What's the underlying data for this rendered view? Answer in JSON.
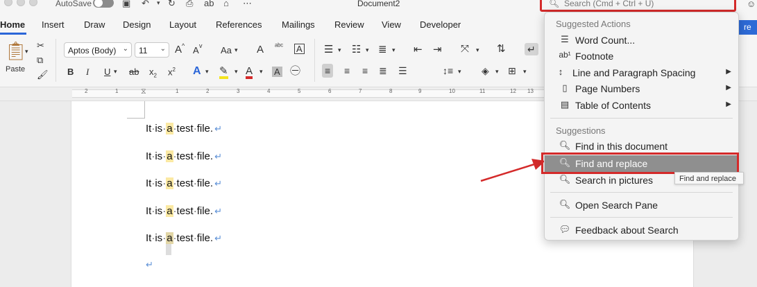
{
  "titlebar": {
    "autosave_label": "AutoSave",
    "document_title": "Document2",
    "search_placeholder": "Search (Cmd + Ctrl + U)"
  },
  "tabs": [
    "Home",
    "Insert",
    "Draw",
    "Design",
    "Layout",
    "References",
    "Mailings",
    "Review",
    "View",
    "Developer"
  ],
  "share_label": "re",
  "ribbon": {
    "paste_label": "Paste",
    "font_name": "Aptos (Body)",
    "font_size": "11",
    "bold": "B",
    "italic": "I",
    "underline": "U",
    "strike": "ab",
    "subscript": "x",
    "superscript": "x",
    "grow_font": "A",
    "shrink_font": "A",
    "change_case": "Aa",
    "text_effects": "A",
    "font_color": "A",
    "shading": "A",
    "clear_format": "A"
  },
  "ruler_numbers": [
    "2",
    "1",
    "1",
    "2",
    "3",
    "4",
    "5",
    "6",
    "7",
    "8",
    "9",
    "10",
    "11",
    "12",
    "13"
  ],
  "document": {
    "lines": [
      {
        "before": "It",
        "word2": "is",
        "highlight": "a",
        "word4": "test",
        "word5": "file."
      },
      {
        "before": "It",
        "word2": "is",
        "highlight": "a",
        "word4": "test",
        "word5": "file."
      },
      {
        "before": "It",
        "word2": "is",
        "highlight": "a",
        "word4": "test",
        "word5": "file."
      },
      {
        "before": "It",
        "word2": "is",
        "highlight": "a",
        "word4": "test",
        "word5": "file."
      },
      {
        "before": "It",
        "word2": "is",
        "highlight": "a",
        "word4": "test",
        "word5": "file."
      }
    ],
    "paragraph_mark": "↵"
  },
  "dropdown": {
    "suggested_actions_header": "Suggested Actions",
    "suggested_actions": [
      {
        "label": "Word Count...",
        "icon": "word-count-icon"
      },
      {
        "label": "Footnote",
        "icon": "footnote-icon"
      },
      {
        "label": "Line and Paragraph Spacing",
        "icon": "line-spacing-icon",
        "submenu": true
      },
      {
        "label": "Page Numbers",
        "icon": "page-numbers-icon",
        "submenu": true
      },
      {
        "label": "Table of Contents",
        "icon": "toc-icon",
        "submenu": true
      }
    ],
    "suggestions_header": "Suggestions",
    "suggestions": [
      {
        "label": "Find in this document",
        "icon": "find-icon"
      },
      {
        "label": "Find and replace",
        "icon": "find-replace-icon"
      },
      {
        "label": "Search in pictures",
        "icon": "search-pictures-icon"
      }
    ],
    "open_search_pane": "Open Search Pane",
    "feedback": "Feedback about Search",
    "tooltip": "Find and replace"
  }
}
